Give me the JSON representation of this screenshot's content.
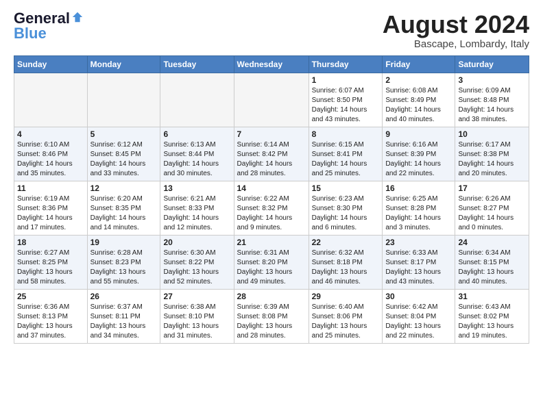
{
  "logo": {
    "line1": "General",
    "line2": "Blue"
  },
  "title": "August 2024",
  "subtitle": "Bascape, Lombardy, Italy",
  "weekdays": [
    "Sunday",
    "Monday",
    "Tuesday",
    "Wednesday",
    "Thursday",
    "Friday",
    "Saturday"
  ],
  "rows": [
    [
      {
        "day": "",
        "info": ""
      },
      {
        "day": "",
        "info": ""
      },
      {
        "day": "",
        "info": ""
      },
      {
        "day": "",
        "info": ""
      },
      {
        "day": "1",
        "info": "Sunrise: 6:07 AM\nSunset: 8:50 PM\nDaylight: 14 hours\nand 43 minutes."
      },
      {
        "day": "2",
        "info": "Sunrise: 6:08 AM\nSunset: 8:49 PM\nDaylight: 14 hours\nand 40 minutes."
      },
      {
        "day": "3",
        "info": "Sunrise: 6:09 AM\nSunset: 8:48 PM\nDaylight: 14 hours\nand 38 minutes."
      }
    ],
    [
      {
        "day": "4",
        "info": "Sunrise: 6:10 AM\nSunset: 8:46 PM\nDaylight: 14 hours\nand 35 minutes."
      },
      {
        "day": "5",
        "info": "Sunrise: 6:12 AM\nSunset: 8:45 PM\nDaylight: 14 hours\nand 33 minutes."
      },
      {
        "day": "6",
        "info": "Sunrise: 6:13 AM\nSunset: 8:44 PM\nDaylight: 14 hours\nand 30 minutes."
      },
      {
        "day": "7",
        "info": "Sunrise: 6:14 AM\nSunset: 8:42 PM\nDaylight: 14 hours\nand 28 minutes."
      },
      {
        "day": "8",
        "info": "Sunrise: 6:15 AM\nSunset: 8:41 PM\nDaylight: 14 hours\nand 25 minutes."
      },
      {
        "day": "9",
        "info": "Sunrise: 6:16 AM\nSunset: 8:39 PM\nDaylight: 14 hours\nand 22 minutes."
      },
      {
        "day": "10",
        "info": "Sunrise: 6:17 AM\nSunset: 8:38 PM\nDaylight: 14 hours\nand 20 minutes."
      }
    ],
    [
      {
        "day": "11",
        "info": "Sunrise: 6:19 AM\nSunset: 8:36 PM\nDaylight: 14 hours\nand 17 minutes."
      },
      {
        "day": "12",
        "info": "Sunrise: 6:20 AM\nSunset: 8:35 PM\nDaylight: 14 hours\nand 14 minutes."
      },
      {
        "day": "13",
        "info": "Sunrise: 6:21 AM\nSunset: 8:33 PM\nDaylight: 14 hours\nand 12 minutes."
      },
      {
        "day": "14",
        "info": "Sunrise: 6:22 AM\nSunset: 8:32 PM\nDaylight: 14 hours\nand 9 minutes."
      },
      {
        "day": "15",
        "info": "Sunrise: 6:23 AM\nSunset: 8:30 PM\nDaylight: 14 hours\nand 6 minutes."
      },
      {
        "day": "16",
        "info": "Sunrise: 6:25 AM\nSunset: 8:28 PM\nDaylight: 14 hours\nand 3 minutes."
      },
      {
        "day": "17",
        "info": "Sunrise: 6:26 AM\nSunset: 8:27 PM\nDaylight: 14 hours\nand 0 minutes."
      }
    ],
    [
      {
        "day": "18",
        "info": "Sunrise: 6:27 AM\nSunset: 8:25 PM\nDaylight: 13 hours\nand 58 minutes."
      },
      {
        "day": "19",
        "info": "Sunrise: 6:28 AM\nSunset: 8:23 PM\nDaylight: 13 hours\nand 55 minutes."
      },
      {
        "day": "20",
        "info": "Sunrise: 6:30 AM\nSunset: 8:22 PM\nDaylight: 13 hours\nand 52 minutes."
      },
      {
        "day": "21",
        "info": "Sunrise: 6:31 AM\nSunset: 8:20 PM\nDaylight: 13 hours\nand 49 minutes."
      },
      {
        "day": "22",
        "info": "Sunrise: 6:32 AM\nSunset: 8:18 PM\nDaylight: 13 hours\nand 46 minutes."
      },
      {
        "day": "23",
        "info": "Sunrise: 6:33 AM\nSunset: 8:17 PM\nDaylight: 13 hours\nand 43 minutes."
      },
      {
        "day": "24",
        "info": "Sunrise: 6:34 AM\nSunset: 8:15 PM\nDaylight: 13 hours\nand 40 minutes."
      }
    ],
    [
      {
        "day": "25",
        "info": "Sunrise: 6:36 AM\nSunset: 8:13 PM\nDaylight: 13 hours\nand 37 minutes."
      },
      {
        "day": "26",
        "info": "Sunrise: 6:37 AM\nSunset: 8:11 PM\nDaylight: 13 hours\nand 34 minutes."
      },
      {
        "day": "27",
        "info": "Sunrise: 6:38 AM\nSunset: 8:10 PM\nDaylight: 13 hours\nand 31 minutes."
      },
      {
        "day": "28",
        "info": "Sunrise: 6:39 AM\nSunset: 8:08 PM\nDaylight: 13 hours\nand 28 minutes."
      },
      {
        "day": "29",
        "info": "Sunrise: 6:40 AM\nSunset: 8:06 PM\nDaylight: 13 hours\nand 25 minutes."
      },
      {
        "day": "30",
        "info": "Sunrise: 6:42 AM\nSunset: 8:04 PM\nDaylight: 13 hours\nand 22 minutes."
      },
      {
        "day": "31",
        "info": "Sunrise: 6:43 AM\nSunset: 8:02 PM\nDaylight: 13 hours\nand 19 minutes."
      }
    ]
  ]
}
